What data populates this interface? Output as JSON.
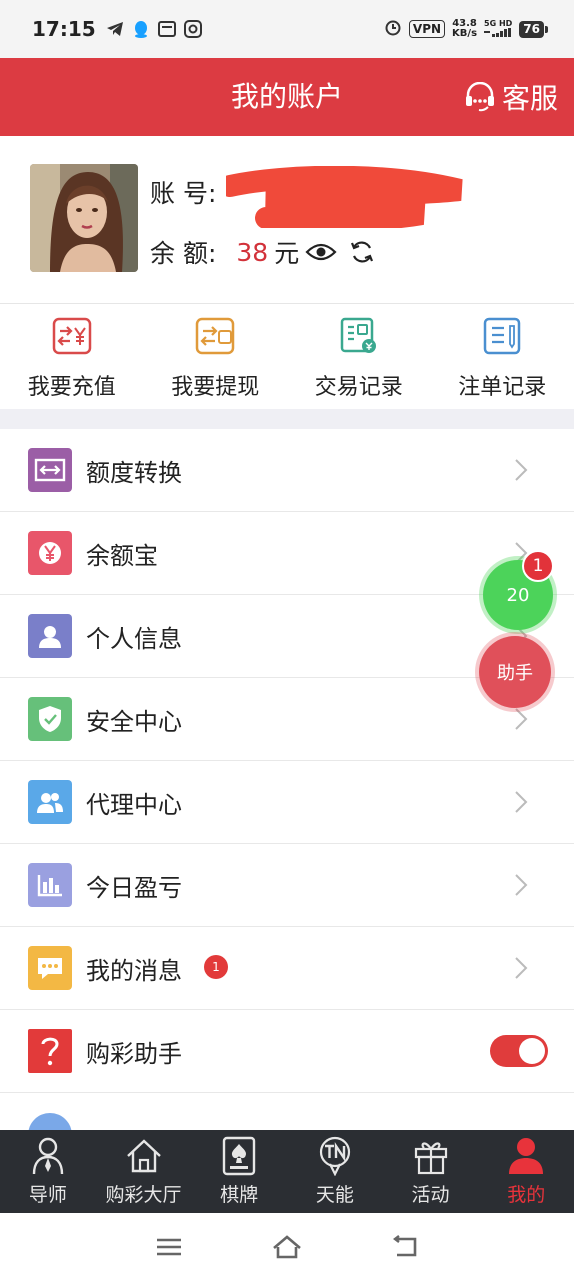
{
  "status_bar": {
    "time": "17:15",
    "vpn": "VPN",
    "speed_value": "43.8",
    "speed_unit": "KB/s",
    "network": "5G HD",
    "battery": "76"
  },
  "header": {
    "title": "我的账户",
    "service_label": "客服",
    "color": "#dc3b42"
  },
  "profile": {
    "account_label": "账 号:",
    "balance_label": "余 额:",
    "balance_value": "38",
    "balance_unit": "元"
  },
  "quick_actions": [
    {
      "label": "我要充值",
      "icon": "recharge-icon",
      "color": "#d94a4a"
    },
    {
      "label": "我要提现",
      "icon": "withdraw-icon",
      "color": "#e09a3a"
    },
    {
      "label": "交易记录",
      "icon": "transaction-icon",
      "color": "#3aa88f"
    },
    {
      "label": "注单记录",
      "icon": "bet-record-icon",
      "color": "#4a8fd0"
    }
  ],
  "menu": [
    {
      "label": "额度转换",
      "icon": "transfer-icon",
      "color": "#9b5ea6"
    },
    {
      "label": "余额宝",
      "icon": "yuan-icon",
      "color": "#e8566a"
    },
    {
      "label": "个人信息",
      "icon": "person-icon",
      "color": "#7a7fc9"
    },
    {
      "label": "安全中心",
      "icon": "shield-icon",
      "color": "#66c07a"
    },
    {
      "label": "代理中心",
      "icon": "agents-icon",
      "color": "#5aa8e8"
    },
    {
      "label": "今日盈亏",
      "icon": "bar-chart-icon",
      "color": "#9aa0e0"
    },
    {
      "label": "我的消息",
      "icon": "message-icon",
      "color": "#f3b844",
      "badge": "1"
    },
    {
      "label": "购彩助手",
      "icon": "question-icon",
      "color": "#e23a3a",
      "toggle": true
    }
  ],
  "floating": {
    "green_value": "20",
    "green_badge": "1",
    "help_label": "助手"
  },
  "tabs": [
    {
      "label": "导师",
      "icon": "mentor-icon"
    },
    {
      "label": "购彩大厅",
      "icon": "home-icon"
    },
    {
      "label": "棋牌",
      "icon": "cards-icon"
    },
    {
      "label": "天能",
      "icon": "tn-icon"
    },
    {
      "label": "活动",
      "icon": "gift-icon"
    },
    {
      "label": "我的",
      "icon": "user-icon",
      "active": true
    }
  ]
}
